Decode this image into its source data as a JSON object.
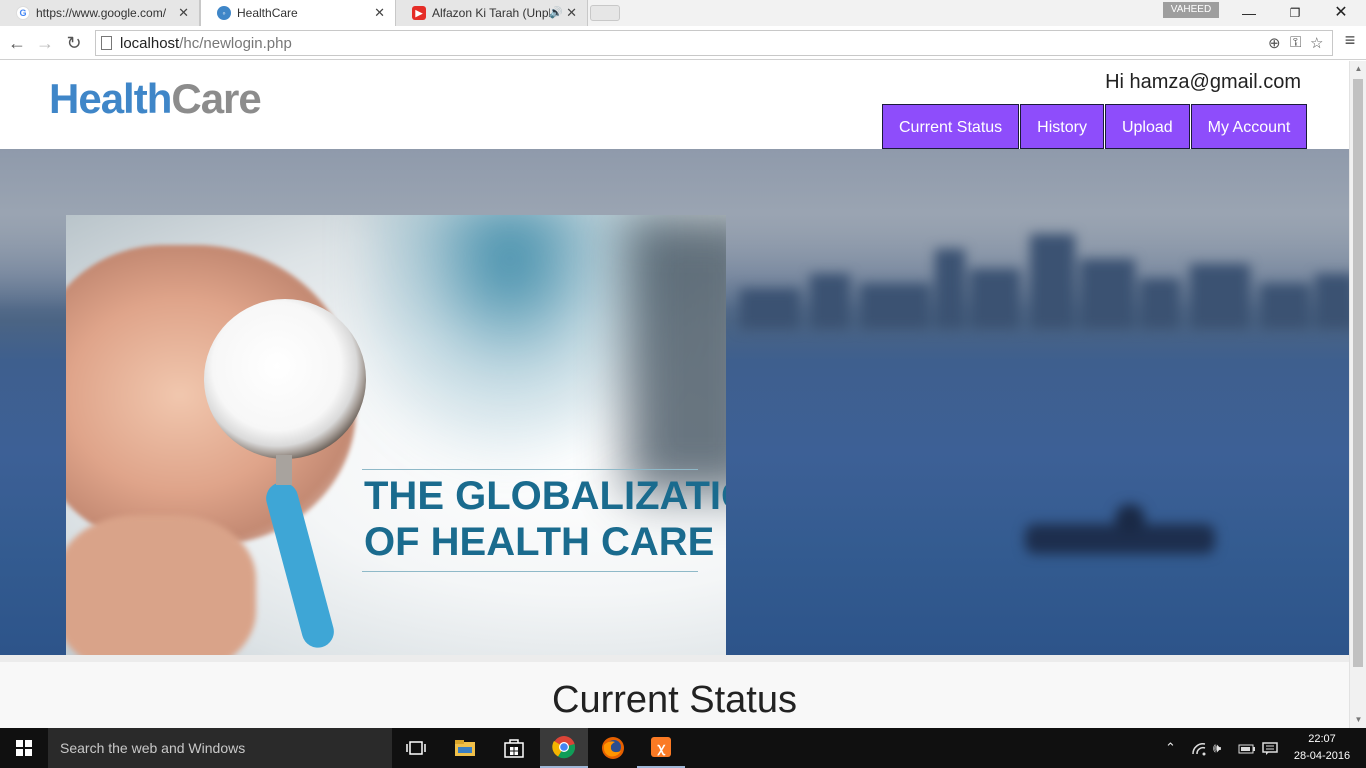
{
  "browser": {
    "tabs": [
      {
        "title": "https://www.google.com/"
      },
      {
        "title": "HealthCare"
      },
      {
        "title": "Alfazon Ki Tarah (Unplu"
      }
    ],
    "profile_name": "VAHEED",
    "url_host": "localhost",
    "url_path": "/hc/newlogin.php"
  },
  "site": {
    "logo_part1": "Health",
    "logo_part2": "Care",
    "greeting": "Hi hamza@gmail.com",
    "nav": [
      {
        "label": "Current Status"
      },
      {
        "label": "History"
      },
      {
        "label": "Upload"
      },
      {
        "label": "My Account"
      }
    ],
    "hero_headline_line1": "THE GLOBALIZATION",
    "hero_headline_line2": "OF HEALTH CARE",
    "section_title": "Current Status"
  },
  "taskbar": {
    "search_placeholder": "Search the web and Windows",
    "time": "22:07",
    "date": "28-04-2016"
  },
  "colors": {
    "nav_bg": "#8e4dfb",
    "logo_health": "#3f86c8",
    "logo_care": "#8c8c8c",
    "headline": "#1a6b8e"
  }
}
